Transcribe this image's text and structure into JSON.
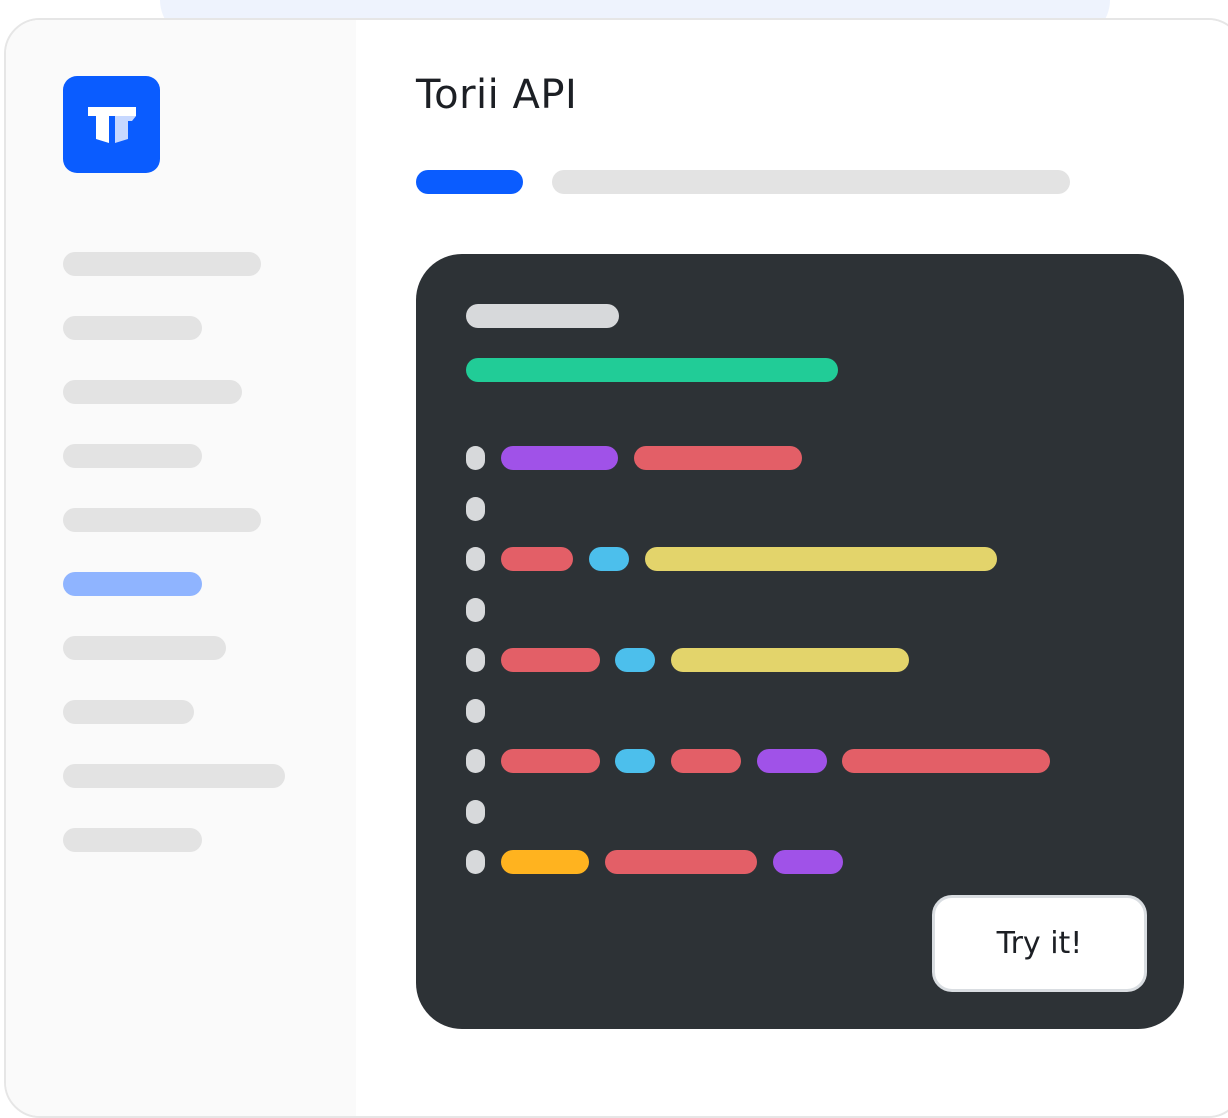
{
  "app": {
    "logo_icon": "torii-logo-icon",
    "brand_color": "#0a5cff"
  },
  "sidebar": {
    "items": [
      {
        "active": false
      },
      {
        "active": false
      },
      {
        "active": false
      },
      {
        "active": false
      },
      {
        "active": false
      },
      {
        "active": true
      },
      {
        "active": false
      },
      {
        "active": false
      },
      {
        "active": false
      },
      {
        "active": false
      }
    ],
    "placeholder_color": "#e3e3e3",
    "active_color": "#8fb4ff"
  },
  "main": {
    "title": "Torii API",
    "tabs": [
      {
        "active": true,
        "color": "#0a5cff"
      },
      {
        "active": false,
        "color": "#e3e3e3"
      }
    ]
  },
  "code_panel": {
    "background": "#2d3236",
    "lines": [
      {
        "tokens": [
          "gray"
        ]
      },
      {
        "tokens": [
          "green"
        ]
      },
      {
        "tokens": []
      },
      {
        "tokens": [
          "gutter",
          "purple",
          "red"
        ]
      },
      {
        "tokens": [
          "gutter"
        ]
      },
      {
        "tokens": [
          "gutter",
          "red",
          "blue",
          "yellow"
        ]
      },
      {
        "tokens": [
          "gutter"
        ]
      },
      {
        "tokens": [
          "gutter",
          "red",
          "blue",
          "yellow"
        ]
      },
      {
        "tokens": [
          "gutter"
        ]
      },
      {
        "tokens": [
          "gutter",
          "red",
          "blue",
          "red",
          "purple",
          "red"
        ]
      },
      {
        "tokens": [
          "gutter"
        ]
      },
      {
        "tokens": [
          "gutter",
          "orange",
          "red",
          "purple"
        ]
      }
    ],
    "token_colors": {
      "gray": "#d7d9db",
      "gutter": "#d7d9db",
      "green": "#21cc97",
      "purple": "#a052e8",
      "red": "#e35f67",
      "blue": "#4cbfec",
      "yellow": "#e3d46b",
      "orange": "#ffb31f"
    },
    "try_button_label": "Try it!"
  }
}
